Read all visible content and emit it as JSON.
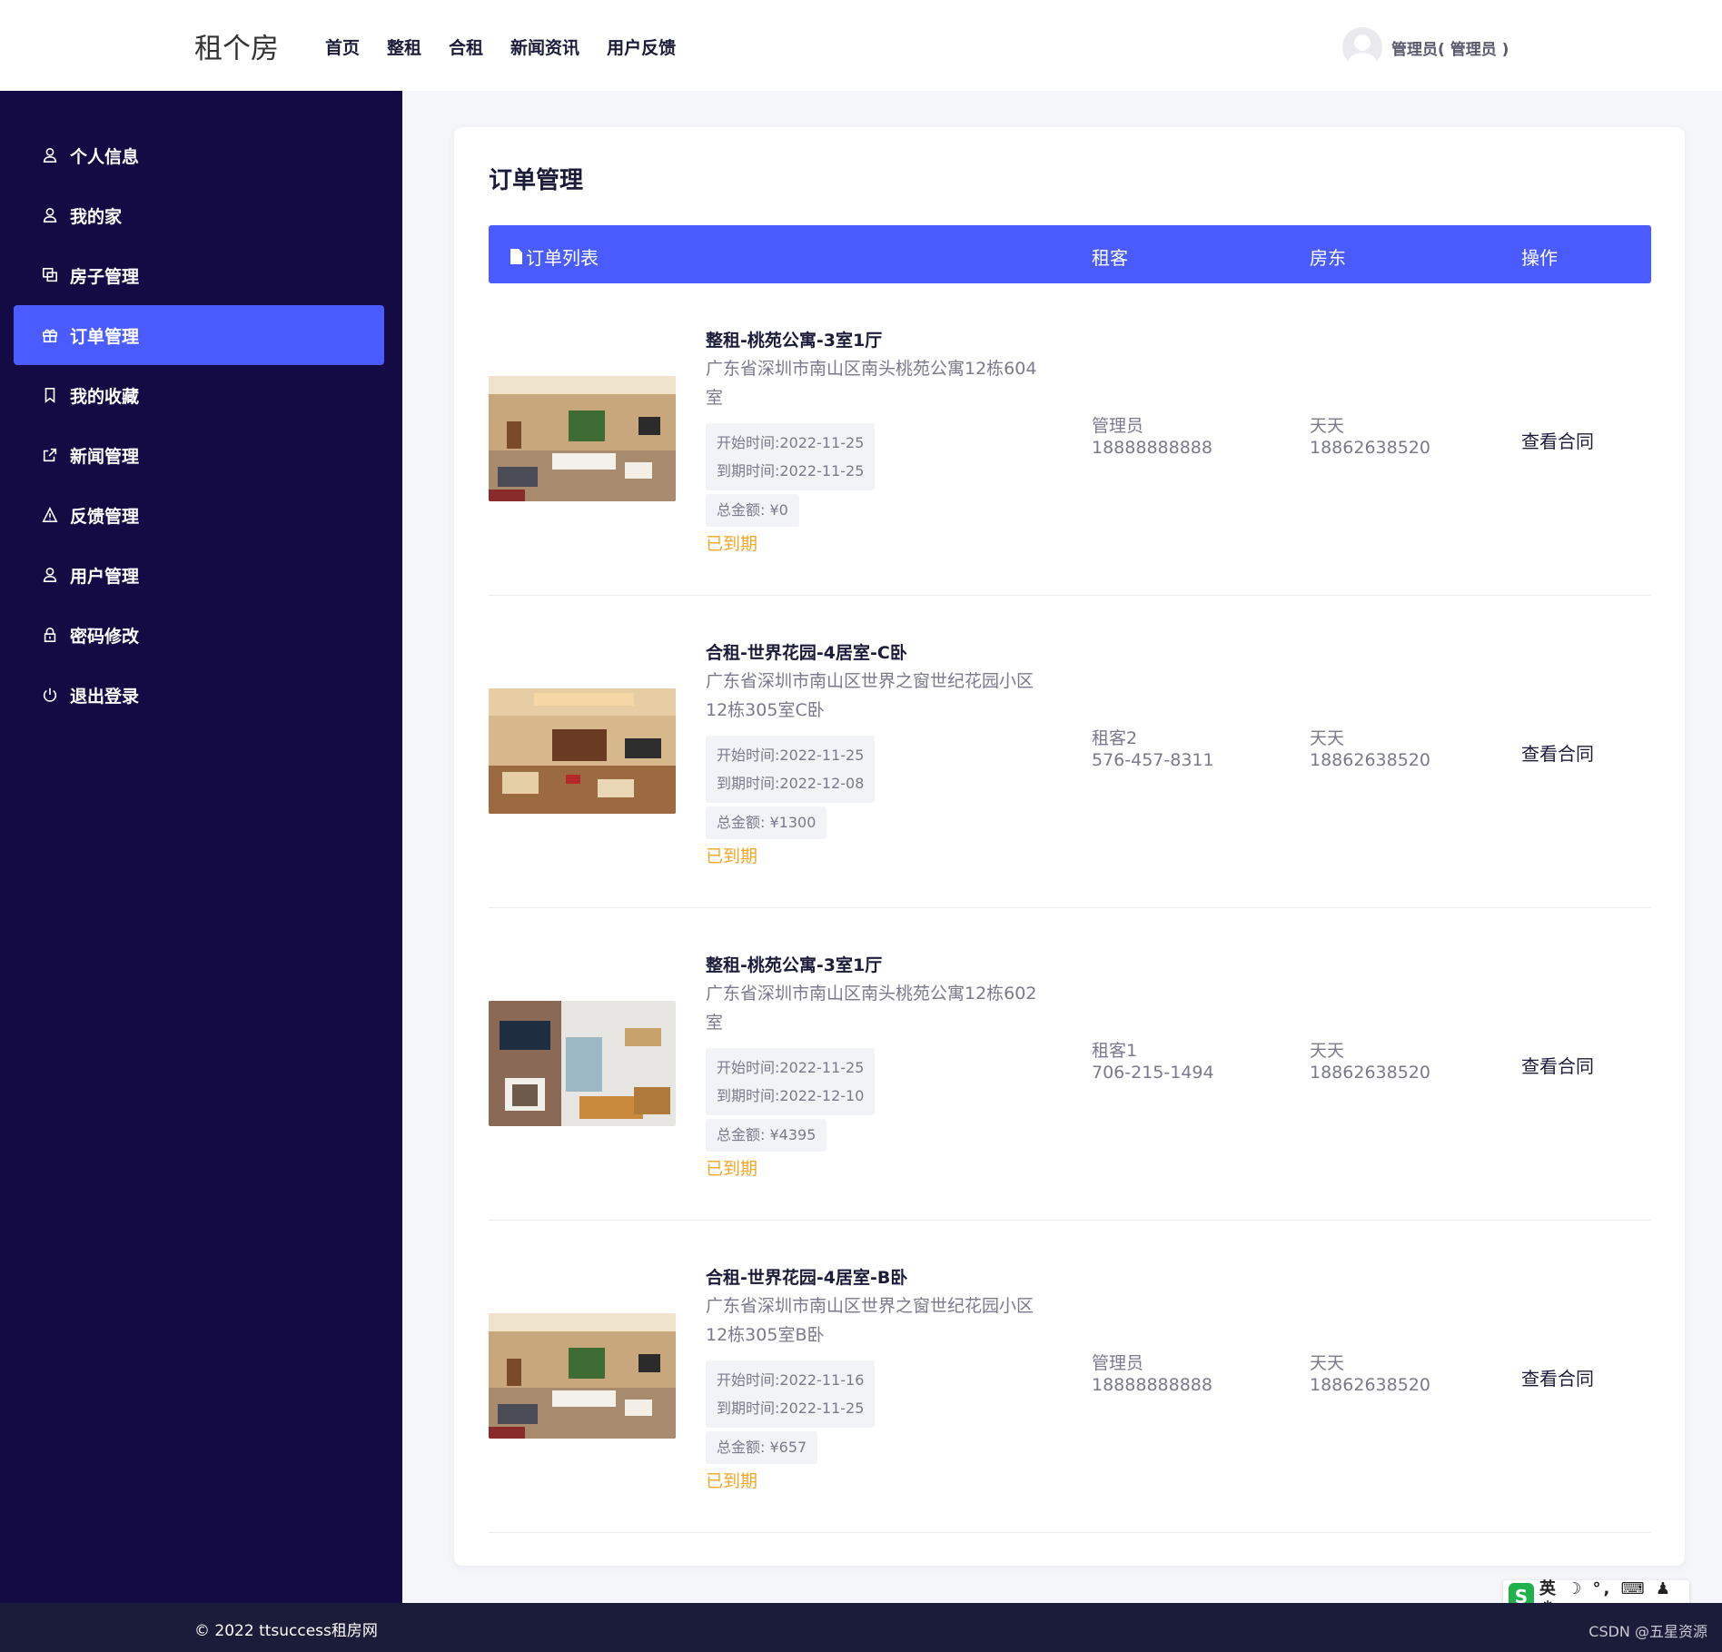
{
  "header": {
    "brand": "租个房",
    "nav": [
      "首页",
      "整租",
      "合租",
      "新闻资讯",
      "用户反馈"
    ],
    "user": "管理员( 管理员 )"
  },
  "sidebar": {
    "items": [
      {
        "label": "个人信息",
        "icon": "user-icon"
      },
      {
        "label": "我的家",
        "icon": "user-icon"
      },
      {
        "label": "房子管理",
        "icon": "copy-icon"
      },
      {
        "label": "订单管理",
        "icon": "gift-icon",
        "active": true
      },
      {
        "label": "我的收藏",
        "icon": "bookmark-icon"
      },
      {
        "label": "新闻管理",
        "icon": "external-link-icon"
      },
      {
        "label": "反馈管理",
        "icon": "warning-icon"
      },
      {
        "label": "用户管理",
        "icon": "user-icon"
      },
      {
        "label": "密码修改",
        "icon": "lock-icon"
      },
      {
        "label": "退出登录",
        "icon": "power-icon"
      }
    ]
  },
  "main": {
    "title": "订单管理",
    "table_head": {
      "list": "订单列表",
      "tenant": "租客",
      "landlord": "房东",
      "action": "操作"
    },
    "orders": [
      {
        "title": "整租-桃苑公寓-3室1厅",
        "address": "广东省深圳市南山区南头桃苑公寓12栋604室",
        "start": "开始时间:2022-11-25",
        "end": "到期时间:2022-11-25",
        "amount": "总金额: ¥0",
        "status": "已到期",
        "tenant_name": "管理员",
        "tenant_phone": "18888888888",
        "landlord_name": "天天",
        "landlord_phone": "18862638520",
        "action": "查看合同"
      },
      {
        "title": "合租-世界花园-4居室-C卧",
        "address": "广东省深圳市南山区世界之窗世纪花园小区12栋305室C卧",
        "start": "开始时间:2022-11-25",
        "end": "到期时间:2022-12-08",
        "amount": "总金额: ¥1300",
        "status": "已到期",
        "tenant_name": "租客2",
        "tenant_phone": "576-457-8311",
        "landlord_name": "天天",
        "landlord_phone": "18862638520",
        "action": "查看合同"
      },
      {
        "title": "整租-桃苑公寓-3室1厅",
        "address": "广东省深圳市南山区南头桃苑公寓12栋602室",
        "start": "开始时间:2022-11-25",
        "end": "到期时间:2022-12-10",
        "amount": "总金额: ¥4395",
        "status": "已到期",
        "tenant_name": "租客1",
        "tenant_phone": "706-215-1494",
        "landlord_name": "天天",
        "landlord_phone": "18862638520",
        "action": "查看合同"
      },
      {
        "title": "合租-世界花园-4居室-B卧",
        "address": "广东省深圳市南山区世界之窗世纪花园小区12栋305室B卧",
        "start": "开始时间:2022-11-16",
        "end": "到期时间:2022-11-25",
        "amount": "总金额: ¥657",
        "status": "已到期",
        "tenant_name": "管理员",
        "tenant_phone": "18888888888",
        "landlord_name": "天天",
        "landlord_phone": "18862638520",
        "action": "查看合同"
      }
    ]
  },
  "footer": {
    "copyright": "© 2022 ttsuccess租房网",
    "watermark": "CSDN @五星资源"
  },
  "ime": {
    "logo": "S",
    "text": "英 ☽ °, ⌨ ♟ ⁂"
  },
  "colors": {
    "sidebar": "#140b45",
    "accent": "#4a5cff",
    "status": "#f5a623"
  }
}
